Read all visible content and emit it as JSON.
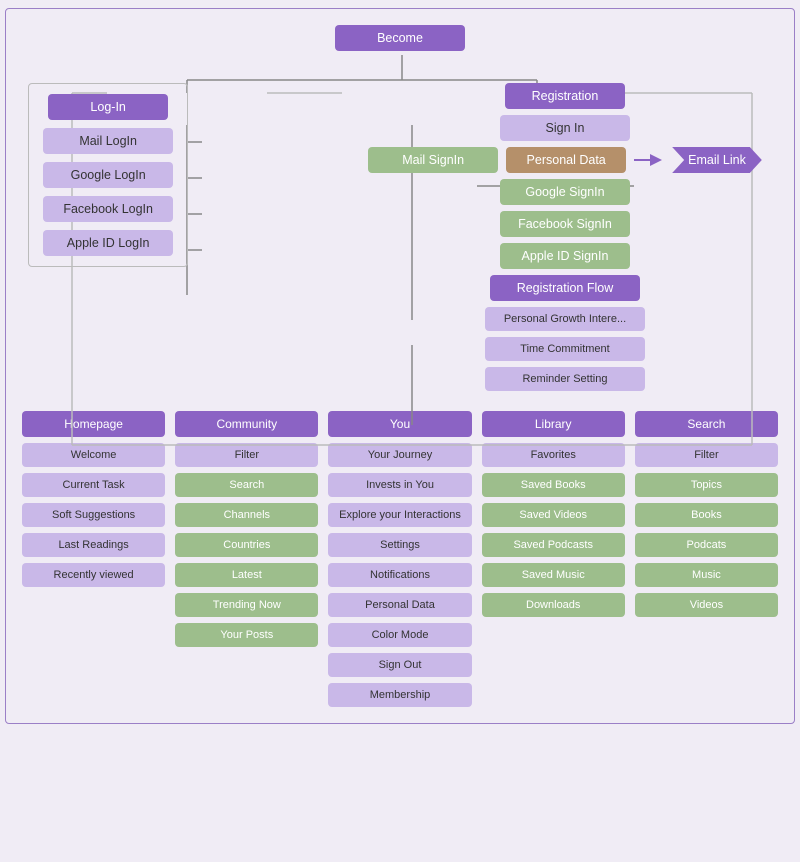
{
  "top": {
    "become": "Become",
    "login": {
      "header": "Log-In",
      "items": [
        "Mail LogIn",
        "Google LogIn",
        "Facebook LogIn",
        "Apple ID LogIn"
      ]
    },
    "registration": {
      "header": "Registration",
      "signIn": "Sign In",
      "items_green": [
        "Mail SignIn",
        "Google SignIn",
        "Facebook SignIn",
        "Apple ID SignIn"
      ],
      "personal_data": "Personal Data",
      "email_link": "Email Link",
      "reg_flow": "Registration Flow",
      "sub_items": [
        "Personal Growth Intere...",
        "Time Commitment",
        "Reminder Setting"
      ]
    }
  },
  "bottom": {
    "columns": [
      {
        "header": "Homepage",
        "items": [
          {
            "label": "Welcome",
            "style": "light"
          },
          {
            "label": "Current Task",
            "style": "light"
          },
          {
            "label": "Soft Suggestions",
            "style": "light"
          },
          {
            "label": "Last Readings",
            "style": "light"
          },
          {
            "label": "Recently viewed",
            "style": "light"
          }
        ]
      },
      {
        "header": "Community",
        "items": [
          {
            "label": "Filter",
            "style": "light"
          },
          {
            "label": "Search",
            "style": "green"
          },
          {
            "label": "Channels",
            "style": "green"
          },
          {
            "label": "Countries",
            "style": "green"
          },
          {
            "label": "Latest",
            "style": "green"
          },
          {
            "label": "Trending Now",
            "style": "green"
          },
          {
            "label": "Your Posts",
            "style": "green"
          }
        ]
      },
      {
        "header": "You",
        "items": [
          {
            "label": "Your Journey",
            "style": "light"
          },
          {
            "label": "Invests in You",
            "style": "light"
          },
          {
            "label": "Explore your Interactions",
            "style": "light"
          },
          {
            "label": "Settings",
            "style": "light"
          },
          {
            "label": "Notifications",
            "style": "light"
          },
          {
            "label": "Personal Data",
            "style": "light"
          },
          {
            "label": "Color Mode",
            "style": "light"
          },
          {
            "label": "Sign Out",
            "style": "light"
          },
          {
            "label": "Membership",
            "style": "light"
          }
        ]
      },
      {
        "header": "Library",
        "items": [
          {
            "label": "Favorites",
            "style": "light"
          },
          {
            "label": "Saved Books",
            "style": "green"
          },
          {
            "label": "Saved Videos",
            "style": "green"
          },
          {
            "label": "Saved Podcasts",
            "style": "green"
          },
          {
            "label": "Saved Music",
            "style": "green"
          },
          {
            "label": "Downloads",
            "style": "green"
          }
        ]
      },
      {
        "header": "Search",
        "items": [
          {
            "label": "Filter",
            "style": "light"
          },
          {
            "label": "Topics",
            "style": "green"
          },
          {
            "label": "Books",
            "style": "green"
          },
          {
            "label": "Podcats",
            "style": "green"
          },
          {
            "label": "Music",
            "style": "green"
          },
          {
            "label": "Videos",
            "style": "green"
          }
        ]
      }
    ]
  }
}
